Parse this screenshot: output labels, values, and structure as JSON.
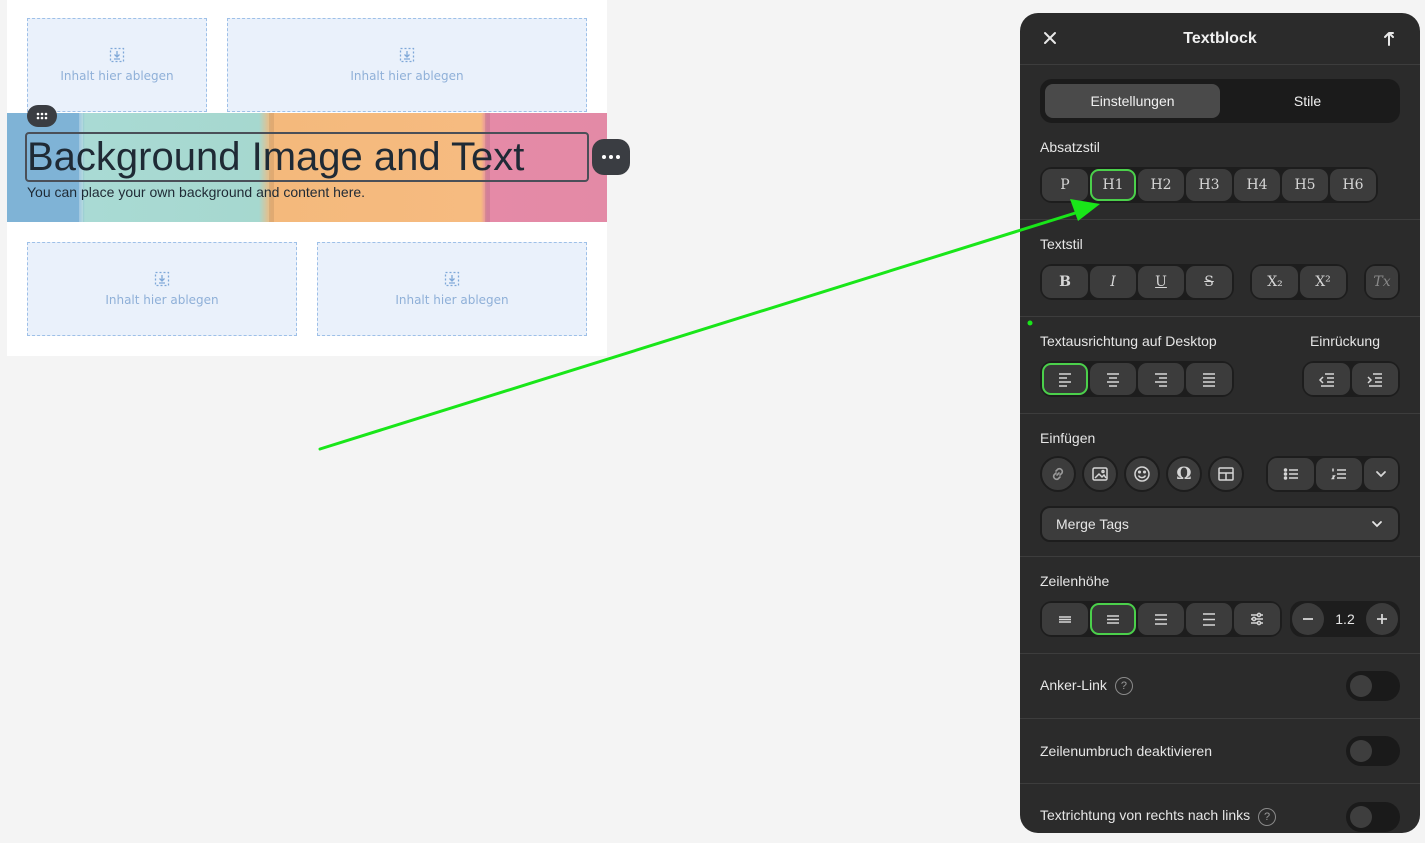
{
  "canvas": {
    "drop_label": "Inhalt hier ablegen",
    "banner_title": "Background Image and Text",
    "banner_subtitle": "You can place your own background and content here."
  },
  "panel": {
    "title": "Textblock",
    "tabs": [
      "Einstellungen",
      "Stile"
    ],
    "active_tab": "Einstellungen",
    "absatzstil": {
      "label": "Absatzstil",
      "options": [
        "P",
        "H1",
        "H2",
        "H3",
        "H4",
        "H5",
        "H6"
      ],
      "selected": "H1"
    },
    "textstil": {
      "label": "Textstil",
      "buttons": [
        "B",
        "I",
        "U",
        "S",
        "X₂",
        "X²",
        "Tx"
      ]
    },
    "alignment": {
      "label": "Textausrichtung auf Desktop",
      "options": [
        "left",
        "center",
        "right",
        "justify"
      ],
      "selected": "left",
      "indent_label": "Einrückung"
    },
    "insert": {
      "label": "Einfügen",
      "icons": [
        "link-icon",
        "image-icon",
        "emoji-icon",
        "omega-icon",
        "table-icon",
        "bullet-list-icon",
        "numbered-list-icon",
        "chevron-down-icon"
      ]
    },
    "merge_tags": {
      "label": "Merge Tags"
    },
    "line_height": {
      "label": "Zeilenhöhe",
      "selected_index": 1,
      "value": "1.2"
    },
    "toggles": [
      {
        "label": "Anker-Link",
        "help": true,
        "on": false
      },
      {
        "label": "Zeilenumbruch deaktivieren",
        "help": false,
        "on": false
      },
      {
        "label": "Textrichtung von rechts nach links",
        "help": true,
        "on": false
      }
    ]
  },
  "colors": {
    "accent_green": "#4bd04b",
    "annotation_arrow": "#19e619",
    "panel_bg": "#2b2b2b"
  }
}
